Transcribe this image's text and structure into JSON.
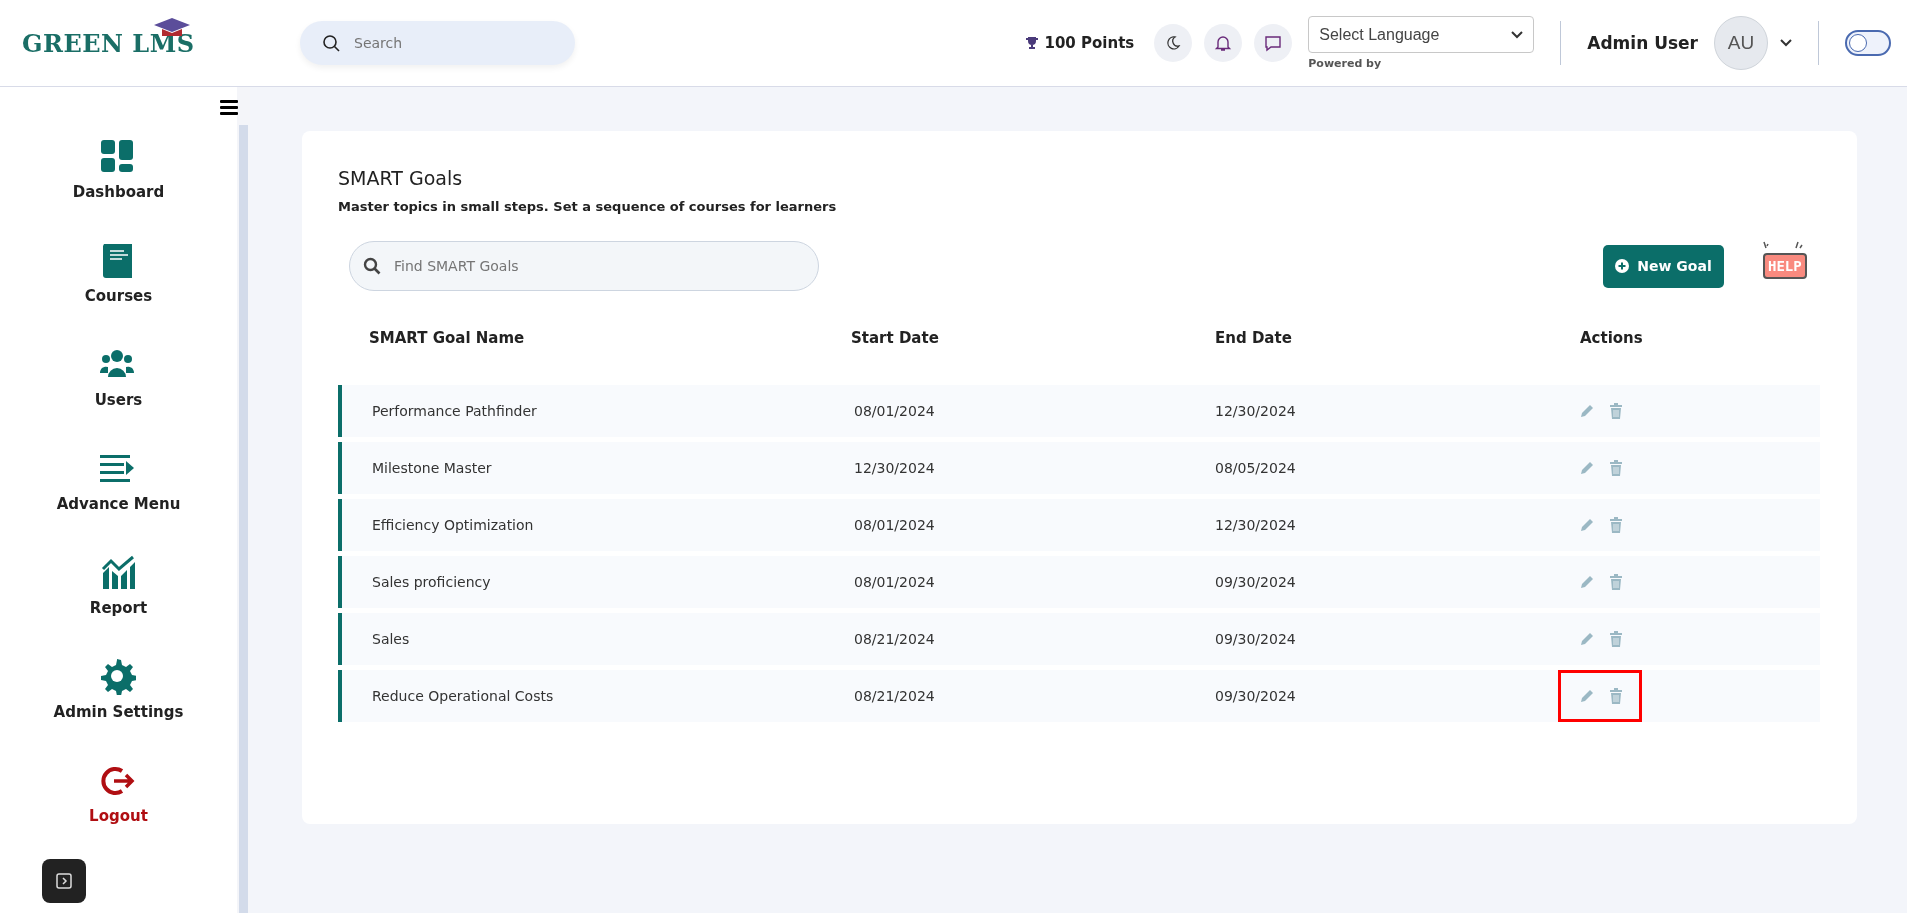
{
  "header": {
    "logo": "GREEN LMS",
    "search": {
      "placeholder": "Search"
    },
    "points": "100 Points",
    "language": {
      "value": "Select Language",
      "note": "Powered by"
    },
    "user": {
      "name": "Admin User",
      "initials": "AU"
    },
    "toggle": {
      "on": false
    }
  },
  "sidebar": {
    "items": [
      {
        "label": "Dashboard",
        "kind": "dashboard",
        "danger": false
      },
      {
        "label": "Courses",
        "kind": "courses",
        "danger": false
      },
      {
        "label": "Users",
        "kind": "users",
        "danger": false
      },
      {
        "label": "Advance Menu",
        "kind": "menu",
        "danger": false
      },
      {
        "label": "Report",
        "kind": "report",
        "danger": false
      },
      {
        "label": "Admin Settings",
        "kind": "settings",
        "danger": false
      },
      {
        "label": "Logout",
        "kind": "logout",
        "danger": true
      }
    ]
  },
  "page": {
    "title": "SMART Goals",
    "subtitle": "Master topics in small steps. Set a sequence of courses for learners",
    "search": {
      "placeholder": "Find SMART Goals"
    },
    "new_button": "New Goal",
    "help": "HELP"
  },
  "table": {
    "columns": [
      "SMART Goal Name",
      "Start Date",
      "End Date",
      "Actions"
    ],
    "rows": [
      {
        "name": "Performance Pathfinder",
        "start": "08/01/2024",
        "end": "12/30/2024",
        "highlighted": false
      },
      {
        "name": "Milestone Master",
        "start": "12/30/2024",
        "end": "08/05/2024",
        "highlighted": false
      },
      {
        "name": "Efficiency Optimization",
        "start": "08/01/2024",
        "end": "12/30/2024",
        "highlighted": false
      },
      {
        "name": "Sales proficiency",
        "start": "08/01/2024",
        "end": "09/30/2024",
        "highlighted": false
      },
      {
        "name": "Sales",
        "start": "08/21/2024",
        "end": "09/30/2024",
        "highlighted": false
      },
      {
        "name": "Reduce Operational Costs",
        "start": "08/21/2024",
        "end": "09/30/2024",
        "highlighted": true
      }
    ]
  }
}
